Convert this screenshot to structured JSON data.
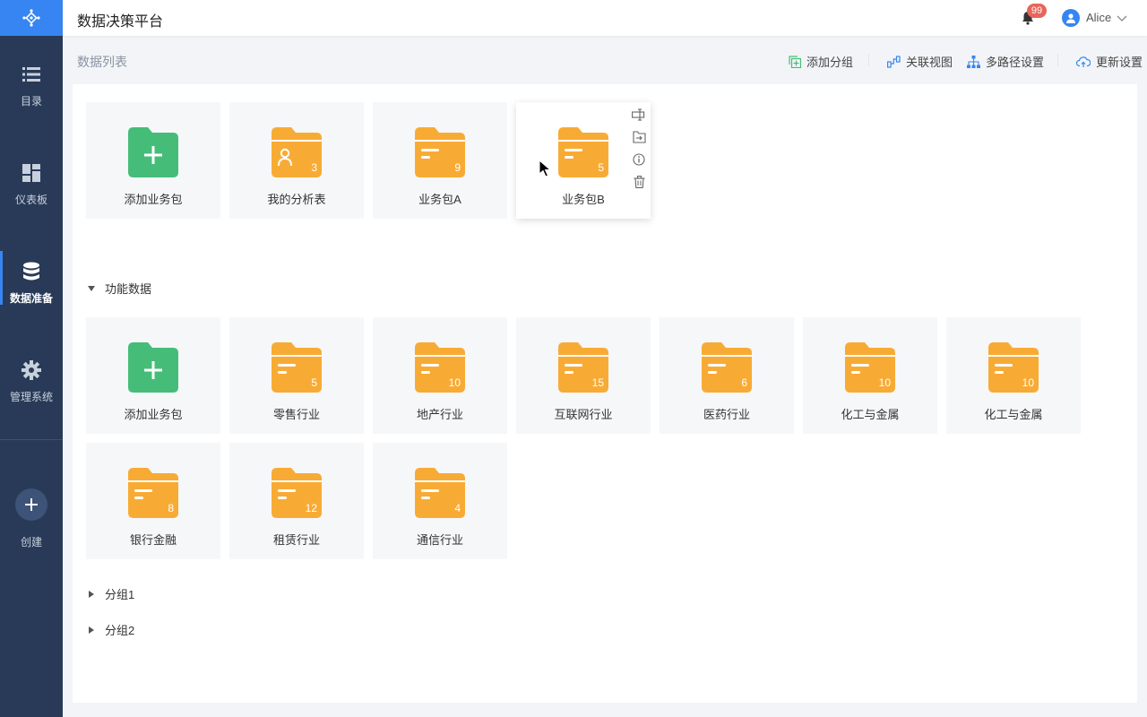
{
  "app": {
    "title": "数据决策平台"
  },
  "sidebar": {
    "items": [
      {
        "label": "目录",
        "icon": "list-icon"
      },
      {
        "label": "仪表板",
        "icon": "dashboard-icon"
      },
      {
        "label": "数据准备",
        "icon": "database-icon",
        "active": true
      },
      {
        "label": "管理系统",
        "icon": "gear-icon"
      }
    ],
    "create_label": "创建"
  },
  "header": {
    "notification_count": "99",
    "user_name": "Alice"
  },
  "toolbar": {
    "list_title": "数据列表",
    "add_group": "添加分组",
    "relation_view": "关联视图",
    "multipath_settings": "多路径设置",
    "update_settings": "更新设置"
  },
  "top_cards": [
    {
      "label": "添加业务包",
      "type": "add"
    },
    {
      "label": "我的分析表",
      "type": "user",
      "count": "3"
    },
    {
      "label": "业务包A",
      "type": "folder",
      "count": "9"
    },
    {
      "label": "业务包B",
      "type": "folder",
      "count": "5",
      "hovered": true
    }
  ],
  "groups": [
    {
      "name": "功能数据",
      "expanded": true,
      "cards": [
        {
          "label": "添加业务包",
          "type": "add"
        },
        {
          "label": "零售行业",
          "type": "folder",
          "count": "5"
        },
        {
          "label": "地产行业",
          "type": "folder",
          "count": "10"
        },
        {
          "label": "互联网行业",
          "type": "folder",
          "count": "15"
        },
        {
          "label": "医药行业",
          "type": "folder",
          "count": "6"
        },
        {
          "label": "化工与金属",
          "type": "folder",
          "count": "10"
        },
        {
          "label": "化工与金属",
          "type": "folder",
          "count": "10"
        },
        {
          "label": "银行金融",
          "type": "folder",
          "count": "8"
        },
        {
          "label": "租赁行业",
          "type": "folder",
          "count": "12"
        },
        {
          "label": "通信行业",
          "type": "folder",
          "count": "4"
        }
      ]
    },
    {
      "name": "分组1",
      "expanded": false
    },
    {
      "name": "分组2",
      "expanded": false
    }
  ],
  "colors": {
    "sidebar_bg": "#283a57",
    "accent": "#3685f2",
    "folder": "#f8ab34",
    "add_folder": "#45bd78",
    "badge": "#e8655a"
  }
}
